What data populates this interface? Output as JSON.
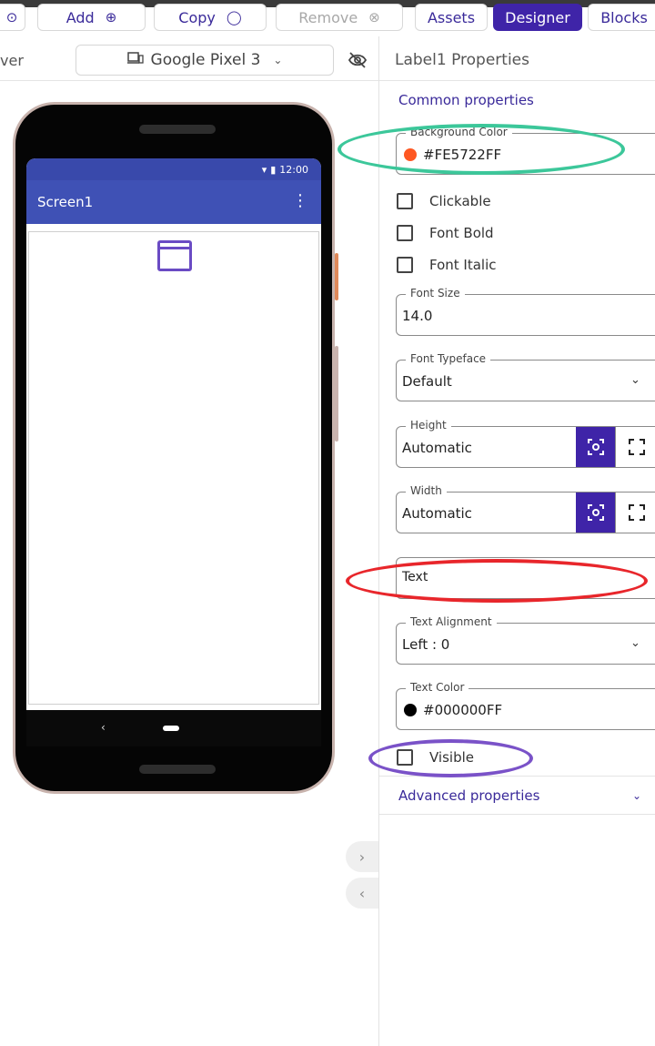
{
  "toolbar": {
    "add_label": "Add",
    "copy_label": "Copy",
    "remove_label": "Remove",
    "assets_label": "Assets",
    "designer_label": "Designer",
    "blocks_label": "Blocks"
  },
  "viewer": {
    "header_partial": "ver",
    "device": "Google Pixel 3",
    "time": "12:00",
    "screen_title": "Screen1"
  },
  "properties": {
    "title": "Label1 Properties",
    "common_section": "Common properties",
    "background_color": {
      "label": "Background Color",
      "value": "#FE5722FF",
      "swatch": "#FE5722"
    },
    "clickable": "Clickable",
    "font_bold": "Font Bold",
    "font_italic": "Font Italic",
    "font_size": {
      "label": "Font Size",
      "value": "14.0"
    },
    "font_typeface": {
      "label": "Font Typeface",
      "value": "Default"
    },
    "height": {
      "label": "Height",
      "value": "Automatic"
    },
    "width": {
      "label": "Width",
      "value": "Automatic"
    },
    "text": {
      "value": "Text"
    },
    "text_alignment": {
      "label": "Text Alignment",
      "value": "Left : 0"
    },
    "text_color": {
      "label": "Text Color",
      "value": "#000000FF",
      "swatch": "#000000"
    },
    "visible": "Visible",
    "advanced_section": "Advanced properties"
  },
  "colors": {
    "accent": "#3F24A8",
    "appbar": "#3F51B5",
    "annotation_green": "#3CC79A",
    "annotation_red": "#E8262B",
    "annotation_purple": "#7A52C8"
  }
}
